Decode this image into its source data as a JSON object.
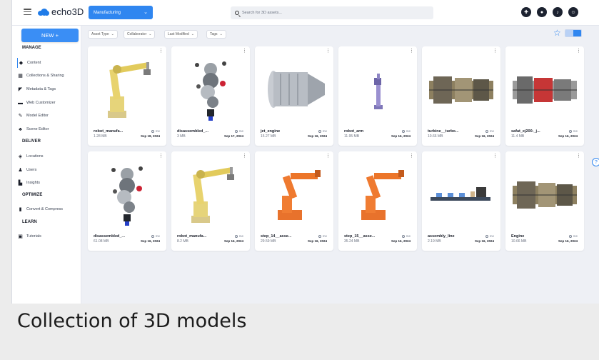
{
  "app": {
    "logo_text": "echo3D",
    "workspace": "Manufacturing",
    "search_placeholder": "Search for 3D assets..."
  },
  "sidebar": {
    "new_button": "NEW +",
    "manage_heading": "MANAGE",
    "manage_items": [
      "Content",
      "Collections & Sharing",
      "Metadata & Tags",
      "Web Customizer",
      "Model Editor",
      "Scene Editor"
    ],
    "deliver_heading": "DELIVER",
    "deliver_items": [
      "Locations",
      "Users",
      "Insights"
    ],
    "optimize_heading": "OPTIMIZE",
    "optimize_items": [
      "Convert & Compress"
    ],
    "learn_heading": "LEARN",
    "learn_items": [
      "Tutorials"
    ]
  },
  "filters": [
    "Asset Type",
    "Collaborator",
    "Last Modified",
    "Tags"
  ],
  "assets": [
    {
      "name": "robot_manufa...",
      "size": "1.28 MB",
      "owner": "me",
      "date": "Sep 18, 2024",
      "thumb": "yellow-robot-arm"
    },
    {
      "name": "disassembled_...",
      "size": "3 MB",
      "owner": "me",
      "date": "Sep 17, 2024",
      "thumb": "exploded-engine"
    },
    {
      "name": "jet_engine",
      "size": "15.27 MB",
      "owner": "me",
      "date": "Sep 16, 2024",
      "thumb": "jet-engine"
    },
    {
      "name": "robot_arm",
      "size": "11.95 MB",
      "owner": "me",
      "date": "Sep 16, 2024",
      "thumb": "purple-robot-arm"
    },
    {
      "name": "turbine__turbo...",
      "size": "10.66 MB",
      "owner": "me",
      "date": "Sep 16, 2024",
      "thumb": "turbine"
    },
    {
      "name": "safat_ej200-_j...",
      "size": "11.4 MB",
      "owner": "me",
      "date": "Sep 16, 2024",
      "thumb": "turbine-red"
    },
    {
      "name": "disassembled_...",
      "size": "61.08 MB",
      "owner": "me",
      "date": "Sep 16, 2024",
      "thumb": "exploded-engine"
    },
    {
      "name": "robot_manufa...",
      "size": "8.2 MB",
      "owner": "me",
      "date": "Sep 16, 2024",
      "thumb": "yellow-robot-arm"
    },
    {
      "name": "step_14__asse...",
      "size": "29.59 MB",
      "owner": "me",
      "date": "Sep 16, 2024",
      "thumb": "orange-robot"
    },
    {
      "name": "step_15__asse...",
      "size": "35.24 MB",
      "owner": "me",
      "date": "Sep 16, 2024",
      "thumb": "orange-robot"
    },
    {
      "name": "assembly_line",
      "size": "2.19 MB",
      "owner": "me",
      "date": "Sep 16, 2024",
      "thumb": "assembly-line"
    },
    {
      "name": "Engine",
      "size": "10.66 MB",
      "owner": "me",
      "date": "Sep 16, 2024",
      "thumb": "turbine"
    }
  ],
  "caption": "Collection of 3D models",
  "colors": {
    "accent": "#2f86f0",
    "background": "#eef0f5"
  }
}
